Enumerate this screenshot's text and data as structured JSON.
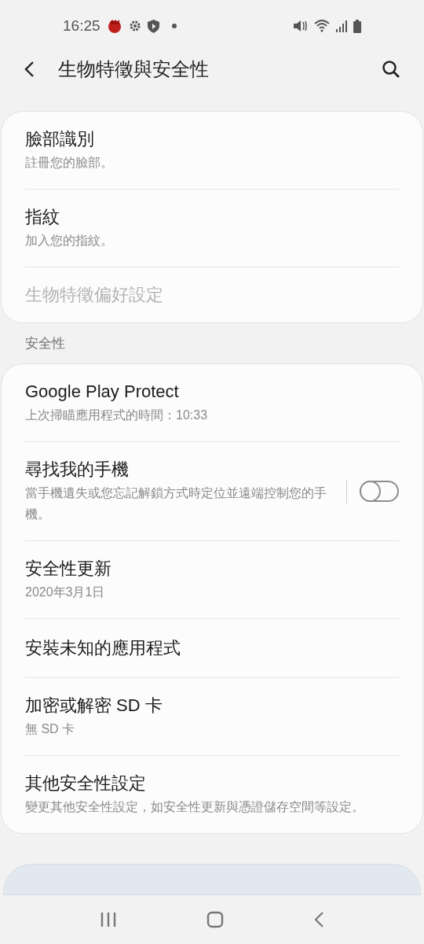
{
  "status_bar": {
    "time": "16:25"
  },
  "header": {
    "title": "生物特徵與安全性"
  },
  "cards": [
    {
      "items": [
        {
          "title": "臉部識別",
          "subtitle": "註冊您的臉部。",
          "disabled": false
        },
        {
          "title": "指紋",
          "subtitle": "加入您的指紋。",
          "disabled": false
        },
        {
          "title": "生物特徵偏好設定",
          "disabled": true
        }
      ]
    },
    {
      "section": "安全性",
      "items": [
        {
          "title": "Google Play Protect",
          "subtitle": "上次掃瞄應用程式的時間：10:33",
          "disabled": false
        },
        {
          "title": "尋找我的手機",
          "subtitle": "當手機遺失或您忘記解鎖方式時定位並遠端控制您的手機。",
          "disabled": false,
          "toggle": {
            "on": false
          }
        },
        {
          "title": "安全性更新",
          "subtitle": "2020年3月1日",
          "disabled": false
        },
        {
          "title": "安裝未知的應用程式",
          "disabled": false
        },
        {
          "title": "加密或解密 SD 卡",
          "subtitle": "無 SD 卡",
          "disabled": false
        },
        {
          "title": "其他安全性設定",
          "subtitle": "變更其他安全性設定，如安全性更新與憑證儲存空間等設定。",
          "disabled": false
        }
      ]
    }
  ]
}
